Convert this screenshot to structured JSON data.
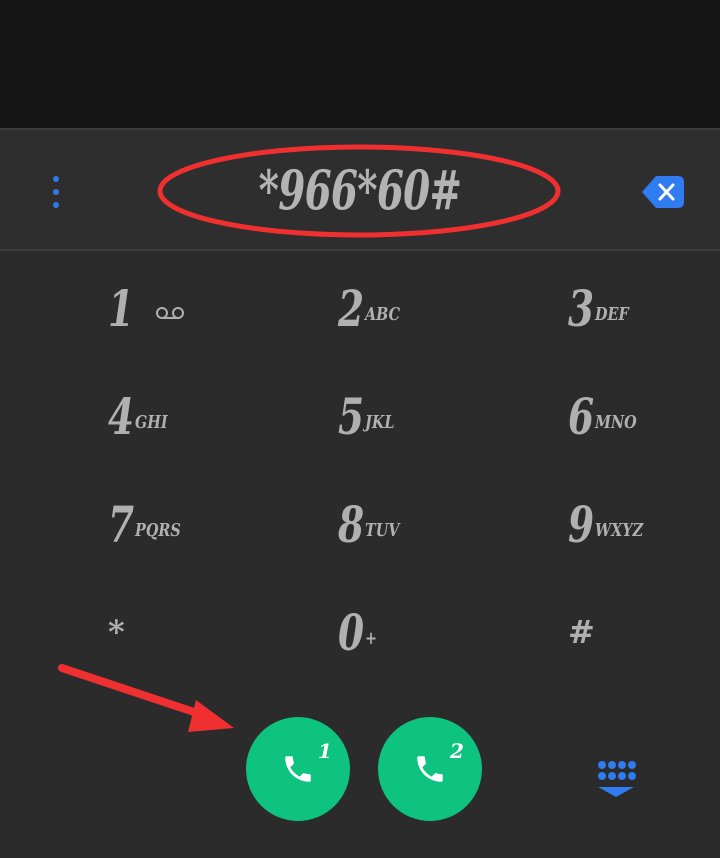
{
  "dialer": {
    "dialed_number": "*966*60#",
    "keys": [
      {
        "digit": "1",
        "letters": "",
        "icon": "voicemail-icon"
      },
      {
        "digit": "2",
        "letters": "ABC"
      },
      {
        "digit": "3",
        "letters": "DEF"
      },
      {
        "digit": "4",
        "letters": "GHI"
      },
      {
        "digit": "5",
        "letters": "JKL"
      },
      {
        "digit": "6",
        "letters": "MNO"
      },
      {
        "digit": "7",
        "letters": "PQRS"
      },
      {
        "digit": "8",
        "letters": "TUV"
      },
      {
        "digit": "9",
        "letters": "WXYZ"
      },
      {
        "digit": "*",
        "letters": ""
      },
      {
        "digit": "0",
        "letters": "+"
      },
      {
        "digit": "#",
        "letters": ""
      }
    ],
    "call_buttons": [
      {
        "sim": "1",
        "icon": "phone-icon"
      },
      {
        "sim": "2",
        "icon": "phone-icon"
      }
    ]
  },
  "colors": {
    "accent": "#2f7bf0",
    "call_green": "#0ec27f",
    "annotation_red": "#f03030",
    "text_gray": "#b0b0b0"
  }
}
